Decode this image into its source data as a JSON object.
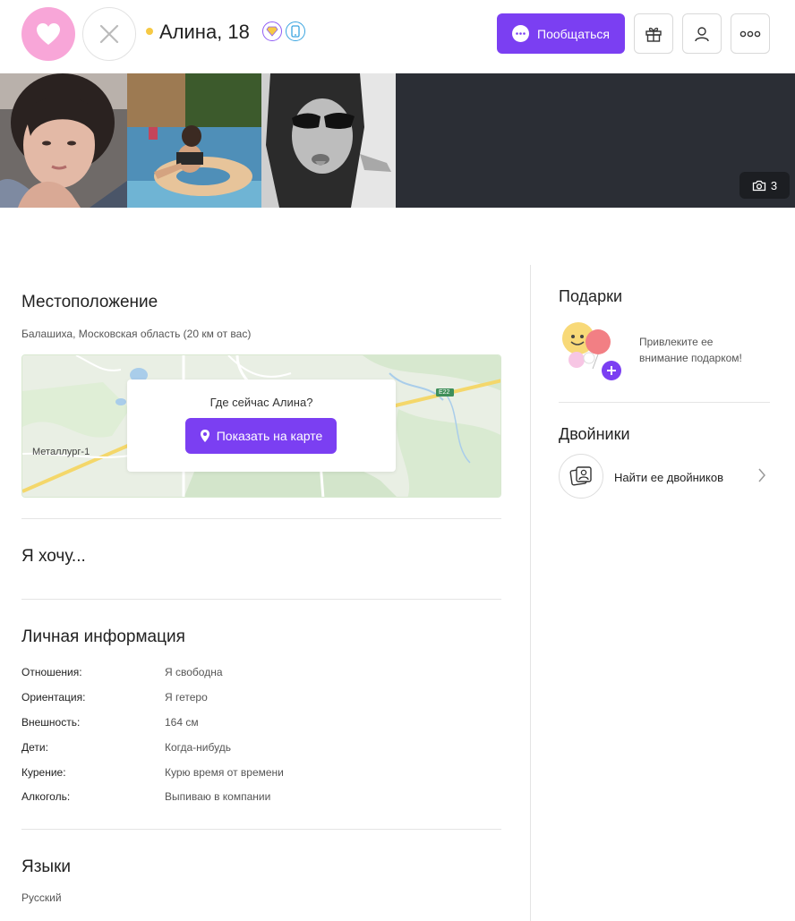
{
  "profile": {
    "name_age": "Алина, 18",
    "photo_count": "3"
  },
  "header": {
    "chat_button": "Пообщаться",
    "like_icon": "heart-icon",
    "skip_icon": "close-icon",
    "vip_badge_icon": "diamond-icon",
    "mobile_badge_icon": "mobile-icon",
    "gift_icon": "gift-icon",
    "profile_icon": "user-icon",
    "more_icon": "more-icon"
  },
  "location": {
    "title": "Местоположение",
    "address": "Балашиха, Московская область (20 км от вас)",
    "map_label": "Металлург-1",
    "map_road_label": "E22",
    "question": "Где сейчас Алина?",
    "show_map_button": "Показать на карте"
  },
  "wants": {
    "title": "Я хочу..."
  },
  "personal": {
    "title": "Личная информация",
    "rows": [
      {
        "label": "Отношения:",
        "value": "Я свободна"
      },
      {
        "label": "Ориентация:",
        "value": "Я гетеро"
      },
      {
        "label": "Внешность:",
        "value": "164 см"
      },
      {
        "label": "Дети:",
        "value": "Когда-нибудь"
      },
      {
        "label": "Курение:",
        "value": "Курю время от времени"
      },
      {
        "label": "Алкоголь:",
        "value": "Выпиваю в компании"
      }
    ]
  },
  "languages": {
    "title": "Языки",
    "value": "Русский"
  },
  "gifts": {
    "title": "Подарки",
    "text": "Привлеките ее внимание подарком!"
  },
  "twins": {
    "title": "Двойники",
    "action": "Найти ее двойников"
  },
  "colors": {
    "accent": "#7b3ff2",
    "like": "#f8a6d8",
    "online": "#f6c944",
    "gallery_bg": "#2b2e35"
  }
}
